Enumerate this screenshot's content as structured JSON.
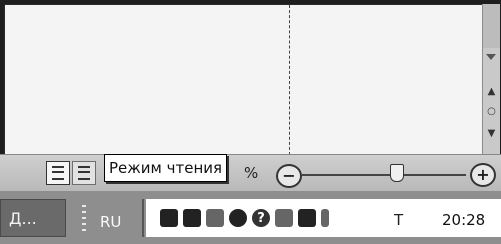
{
  "statusbar": {
    "tooltip": "Режим чтения",
    "zoom_percent": "%",
    "zoom_minus": "−",
    "zoom_plus": "+"
  },
  "taskbar": {
    "task_button_label": "Д...",
    "language": "RU",
    "ime_label": "T",
    "clock": "20:28"
  },
  "icons": {
    "tray": [
      "network-icon",
      "network-icon",
      "printer-icon",
      "antivirus-icon",
      "help-icon",
      "tray-app-icon",
      "tray-app-icon"
    ]
  }
}
